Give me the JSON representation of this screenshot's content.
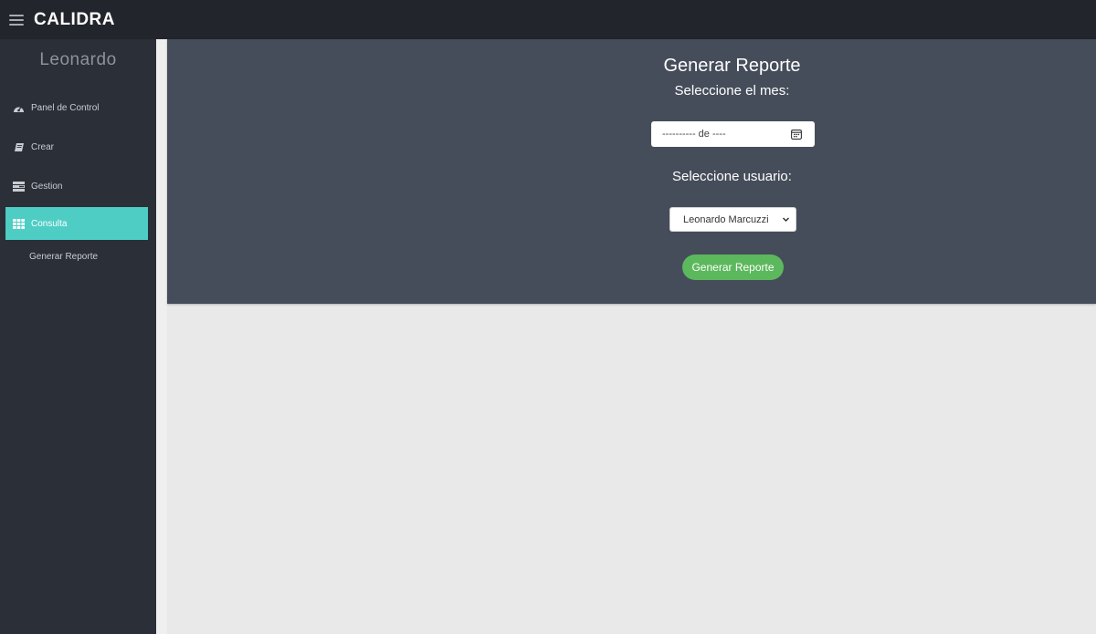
{
  "app": {
    "brand": "CALIDRA"
  },
  "sidebar": {
    "user_name": "Leonardo",
    "items": [
      {
        "label": "Panel de Control",
        "icon": "dashboard-icon"
      },
      {
        "label": "Crear",
        "icon": "book-icon"
      },
      {
        "label": "Gestion",
        "icon": "tasks-icon"
      },
      {
        "label": "Consulta",
        "icon": "table-icon",
        "active": true
      }
    ],
    "sub_item": "Generar Reporte"
  },
  "main": {
    "title": "Generar Reporte",
    "month_label": "Seleccione el mes:",
    "month_input_value": "---------- de ----",
    "user_label": "Seleccione usuario:",
    "user_select_value": "Leonardo Marcuzzi",
    "submit_label": "Generar Reporte"
  },
  "colors": {
    "topbar": "#22252b",
    "sidebar": "#2b2f38",
    "panel": "#464d5a",
    "accent": "#4ecdc4",
    "button": "#5cb85c",
    "background": "#e9e9e9"
  }
}
